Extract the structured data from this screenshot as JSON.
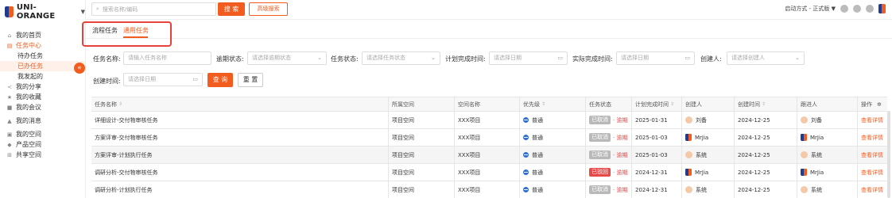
{
  "brand": {
    "name": "UNI-ORANGE"
  },
  "sidebar": {
    "items": [
      {
        "label": "我的首页",
        "icon": "home-icon"
      },
      {
        "label": "任务中心",
        "icon": "task-icon",
        "active": true
      },
      {
        "label": "我的分享",
        "icon": "share-icon"
      },
      {
        "label": "我的收藏",
        "icon": "star-icon"
      },
      {
        "label": "我的会议",
        "icon": "video-icon"
      },
      {
        "label": "我的消息",
        "icon": "bell-icon"
      },
      {
        "label": "我的空间",
        "icon": "space-icon"
      },
      {
        "label": "产品空间",
        "icon": "cube-icon"
      },
      {
        "label": "共享空间",
        "icon": "grid-icon"
      }
    ],
    "sub_items": [
      {
        "label": "待办任务"
      },
      {
        "label": "已办任务",
        "active": true
      },
      {
        "label": "我发起的"
      }
    ]
  },
  "topbar": {
    "search_placeholder": "搜索名称/编码",
    "search_button": "搜 索",
    "advanced_button": "高级搜索",
    "mode_label": "启动方式 - 正式版"
  },
  "tabs": [
    {
      "label": "流程任务"
    },
    {
      "label": "通用任务",
      "active": true
    }
  ],
  "filters": {
    "task_name_label": "任务名称:",
    "task_name_placeholder": "请输入任务名称",
    "overdue_label": "逾期状态:",
    "overdue_placeholder": "请选择逾期状态",
    "status_label": "任务状态:",
    "status_placeholder": "请选择任务状态",
    "plan_time_label": "计划完成时间:",
    "plan_time_placeholder": "请选择日期",
    "actual_time_label": "实际完成时间:",
    "actual_time_placeholder": "请选择日期",
    "creator_label": "创建人:",
    "creator_placeholder": "请选择创建人",
    "created_time_label": "创建时间:",
    "created_time_placeholder": "请选择日期",
    "query_button": "查 询",
    "reset_button": "重 置"
  },
  "table": {
    "headers": [
      "任务名称",
      "所属空间",
      "空间名称",
      "优先级",
      "任务状态",
      "计划完成时间",
      "创建人",
      "创建时间",
      "跟进人",
      "操作"
    ],
    "rows": [
      {
        "name": "详细设计-交付物审核任务",
        "space": "项目空间",
        "space_name": "XXX项目",
        "priority": "普通",
        "status": "已取消",
        "overdue": "· 逾期",
        "plan": "2025-01-31",
        "creator": "刘备",
        "created": "2024-12-25",
        "follower": "刘备",
        "action": "查看详情"
      },
      {
        "name": "方案评审-交付物审核任务",
        "space": "项目空间",
        "space_name": "XXX项目",
        "priority": "普通",
        "status": "已取消",
        "overdue": "· 逾期",
        "plan": "2025-01-03",
        "creator": "MrJia",
        "created": "2024-12-25",
        "follower": "MrJia",
        "action": "查看详情"
      },
      {
        "name": "方案评审-计划执行任务",
        "space": "项目空间",
        "space_name": "XXX项目",
        "priority": "普通",
        "status": "已取消",
        "overdue": "· 逾期",
        "plan": "2025-01-03",
        "creator": "系统",
        "created": "2024-12-25",
        "follower": "系统",
        "action": "查看详情"
      },
      {
        "name": "调研分析-交付物审核任务",
        "space": "项目空间",
        "space_name": "XXX项目",
        "priority": "普通",
        "status": "已驳回",
        "overdue": "· 逾期",
        "plan": "2024-12-31",
        "creator": "MrJia",
        "created": "2024-12-25",
        "follower": "MrJia",
        "action": "查看详情"
      },
      {
        "name": "调研分析-计划执行任务",
        "space": "项目空间",
        "space_name": "XXX项目",
        "priority": "普通",
        "status": "已取消",
        "overdue": "· 逾期",
        "plan": "2024-12-31",
        "creator": "系统",
        "created": "2024-12-25",
        "follower": "系统",
        "action": "查看详情"
      }
    ]
  },
  "colors": {
    "accent": "#f25c1f",
    "brand_blue": "#1f3c8f",
    "danger": "#e84a4a"
  }
}
